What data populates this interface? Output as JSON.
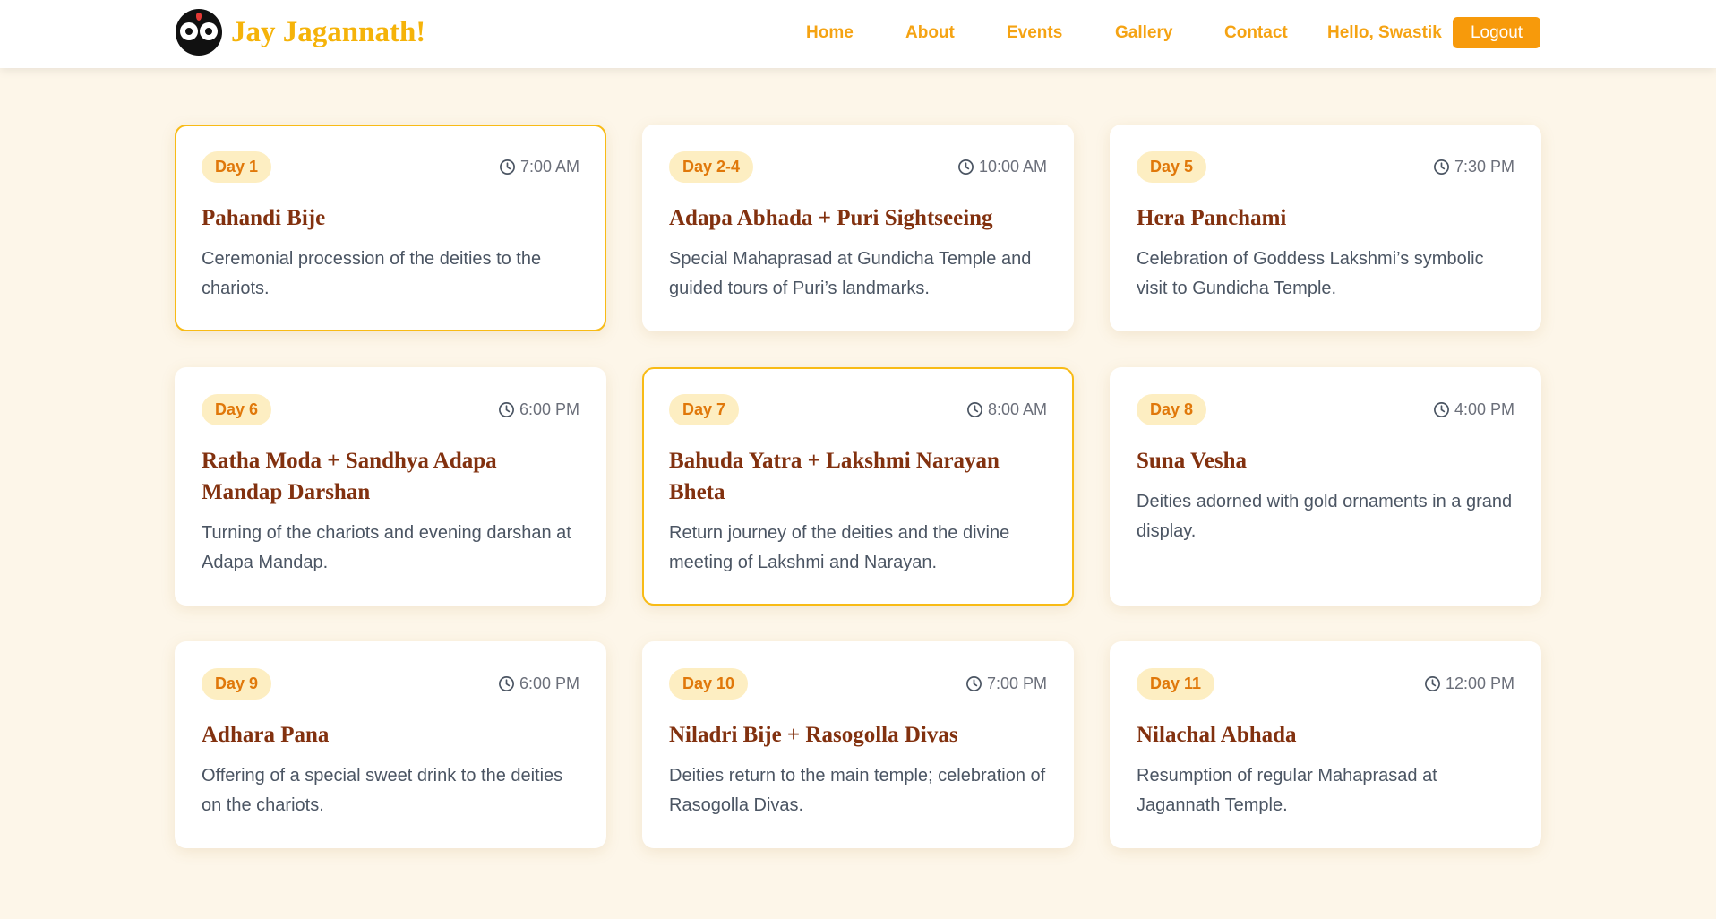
{
  "brand": {
    "name": "Jay Jagannath!"
  },
  "nav": {
    "links": [
      "Home",
      "About",
      "Events",
      "Gallery",
      "Contact"
    ],
    "greeting": "Hello, Swastik",
    "logout_label": "Logout"
  },
  "events": [
    {
      "day": "Day 1",
      "time": "7:00 AM",
      "title": "Pahandi Bije",
      "description": "Ceremonial procession of the deities to the chariots.",
      "highlighted": true
    },
    {
      "day": "Day 2-4",
      "time": "10:00 AM",
      "title": "Adapa Abhada + Puri Sightseeing",
      "description": "Special Mahaprasad at Gundicha Temple and guided tours of Puri’s landmarks.",
      "highlighted": false
    },
    {
      "day": "Day 5",
      "time": "7:30 PM",
      "title": "Hera Panchami",
      "description": "Celebration of Goddess Lakshmi’s symbolic visit to Gundicha Temple.",
      "highlighted": false
    },
    {
      "day": "Day 6",
      "time": "6:00 PM",
      "title": "Ratha Moda + Sandhya Adapa Mandap Darshan",
      "description": "Turning of the chariots and evening darshan at Adapa Mandap.",
      "highlighted": false
    },
    {
      "day": "Day 7",
      "time": "8:00 AM",
      "title": "Bahuda Yatra + Lakshmi Narayan Bheta",
      "description": "Return journey of the deities and the divine meeting of Lakshmi and Narayan.",
      "highlighted": true
    },
    {
      "day": "Day 8",
      "time": "4:00 PM",
      "title": "Suna Vesha",
      "description": "Deities adorned with gold ornaments in a grand display.",
      "highlighted": false
    },
    {
      "day": "Day 9",
      "time": "6:00 PM",
      "title": "Adhara Pana",
      "description": "Offering of a special sweet drink to the deities on the chariots.",
      "highlighted": false
    },
    {
      "day": "Day 10",
      "time": "7:00 PM",
      "title": "Niladri Bije + Rasogolla Divas",
      "description": "Deities return to the main temple; celebration of Rasogolla Divas.",
      "highlighted": false
    },
    {
      "day": "Day 11",
      "time": "12:00 PM",
      "title": "Nilachal Abhada",
      "description": "Resumption of regular Mahaprasad at Jagannath Temple.",
      "highlighted": false
    }
  ],
  "colors": {
    "brand_yellow": "#f5b30a",
    "nav_orange": "#f5a313",
    "logout_orange": "#f79a0b",
    "badge_bg": "#fdeec2",
    "title_brown": "#82310f",
    "highlight_border": "#f8bb16"
  }
}
